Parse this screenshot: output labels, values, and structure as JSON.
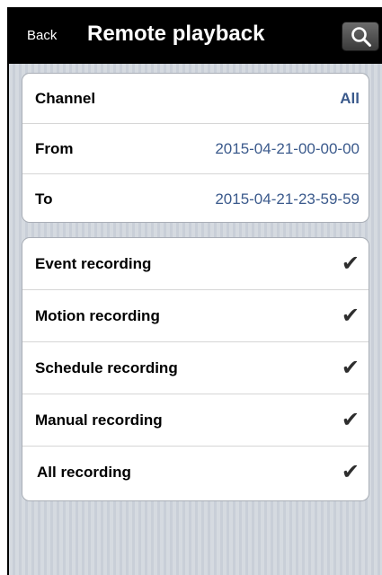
{
  "navbar": {
    "back_label": "Back",
    "title": "Remote playback",
    "search_icon": "search-icon"
  },
  "filters": {
    "channel_label": "Channel",
    "channel_value": "All",
    "from_label": "From",
    "from_value": "2015-04-21-00-00-00",
    "to_label": "To",
    "to_value": "2015-04-21-23-59-59"
  },
  "recording_types": [
    {
      "label": "Event recording",
      "checked": true,
      "check_glyph": "✔"
    },
    {
      "label": "Motion recording",
      "checked": true,
      "check_glyph": "✔"
    },
    {
      "label": "Schedule recording",
      "checked": true,
      "check_glyph": "✔"
    },
    {
      "label": "Manual recording",
      "checked": true,
      "check_glyph": "✔"
    },
    {
      "label": "All recording",
      "checked": true,
      "check_glyph": "✔"
    }
  ],
  "colors": {
    "value_text": "#3b5a8c",
    "navbar_bg": "#000000",
    "page_bg": "#c9cfd8"
  }
}
